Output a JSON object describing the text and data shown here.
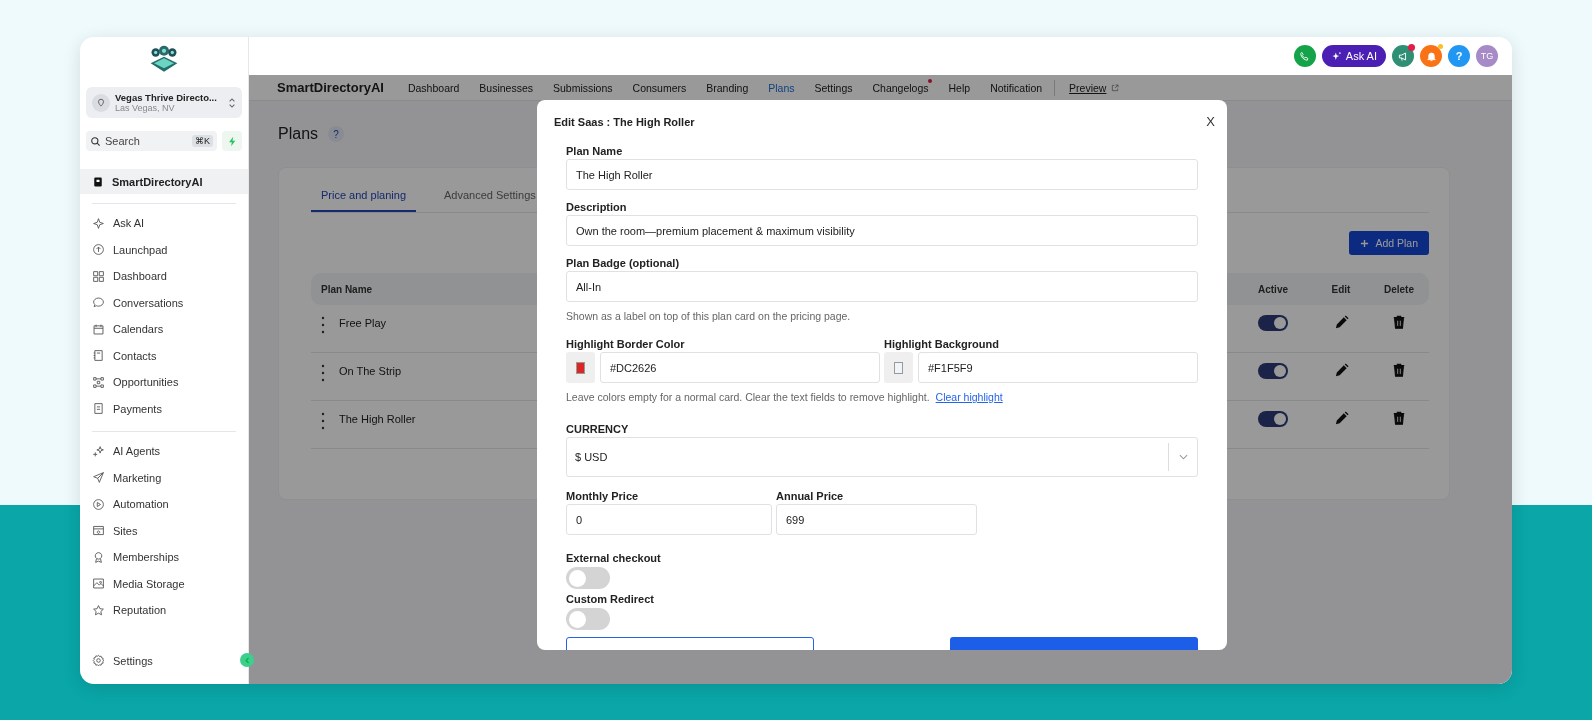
{
  "header": {
    "ask_ai": "Ask AI",
    "help": "?",
    "avatar": "TG"
  },
  "sidebar": {
    "account": {
      "name": "Vegas Thrive Directo...",
      "location": "Las Vegas, NV"
    },
    "search": {
      "placeholder": "Search",
      "shortcut": "⌘K"
    },
    "app_item": {
      "label": "SmartDirectoryAI",
      "selected": true
    },
    "groups": [
      [
        {
          "label": "Ask AI",
          "selected": false
        },
        {
          "label": "Launchpad",
          "selected": false
        },
        {
          "label": "Dashboard",
          "selected": false
        },
        {
          "label": "Conversations",
          "selected": false
        },
        {
          "label": "Calendars",
          "selected": false
        },
        {
          "label": "Contacts",
          "selected": false
        },
        {
          "label": "Opportunities",
          "selected": false
        },
        {
          "label": "Payments",
          "selected": false
        }
      ],
      [
        {
          "label": "AI Agents",
          "selected": false
        },
        {
          "label": "Marketing",
          "selected": false
        },
        {
          "label": "Automation",
          "selected": false
        },
        {
          "label": "Sites",
          "selected": false
        },
        {
          "label": "Memberships",
          "selected": false
        },
        {
          "label": "Media Storage",
          "selected": false
        },
        {
          "label": "Reputation",
          "selected": false
        }
      ]
    ],
    "footer_item": "Settings"
  },
  "nav": {
    "brand": "SmartDirectoryAI",
    "tabs": [
      {
        "label": "Dashboard",
        "selected": false,
        "dot": false
      },
      {
        "label": "Businesses",
        "selected": false,
        "dot": false
      },
      {
        "label": "Submissions",
        "selected": false,
        "dot": false
      },
      {
        "label": "Consumers",
        "selected": false,
        "dot": false
      },
      {
        "label": "Branding",
        "selected": false,
        "dot": false
      },
      {
        "label": "Plans",
        "selected": true,
        "dot": false
      },
      {
        "label": "Settings",
        "selected": false,
        "dot": false
      },
      {
        "label": "Changelogs",
        "selected": false,
        "dot": true
      },
      {
        "label": "Help",
        "selected": false,
        "dot": false
      },
      {
        "label": "Notification",
        "selected": false,
        "dot": false
      }
    ],
    "preview": "Preview"
  },
  "page": {
    "title": "Plans",
    "help": "?",
    "tabs": [
      {
        "label": "Price and planing",
        "selected": true
      },
      {
        "label": "Advanced Settings",
        "selected": false
      }
    ],
    "add_button": "Add Plan",
    "columns": [
      "Plan Name",
      "Active",
      "Edit",
      "Delete"
    ],
    "rows": [
      {
        "name": "Free Play",
        "active": true
      },
      {
        "name": "On The Strip",
        "active": true
      },
      {
        "name": "The High Roller",
        "active": true
      }
    ]
  },
  "modal": {
    "title": "Edit Saas : The High Roller",
    "close": "X",
    "plan_name": {
      "label": "Plan Name",
      "value": "The High Roller"
    },
    "description": {
      "label": "Description",
      "value": "Own the room—premium placement & maximum visibility"
    },
    "badge": {
      "label": "Plan Badge (optional)",
      "value": "All-In",
      "hint": "Shown as a label on top of this plan card on the pricing page."
    },
    "highlight": {
      "border": {
        "label": "Highlight Border Color",
        "value": "#DC2626"
      },
      "background": {
        "label": "Highlight Background",
        "value": "#F1F5F9"
      },
      "hint": "Leave colors empty for a normal card. Clear the text fields to remove highlight.",
      "link": "Clear highlight"
    },
    "currency": {
      "label": "CURRENCY",
      "value": "$ USD"
    },
    "monthly": {
      "label": "Monthly Price",
      "value": "0"
    },
    "annual": {
      "label": "Annual Price",
      "value": "699"
    },
    "toggles": [
      {
        "label": "External checkout",
        "on": false
      },
      {
        "label": "Custom Redirect",
        "on": false
      }
    ]
  }
}
